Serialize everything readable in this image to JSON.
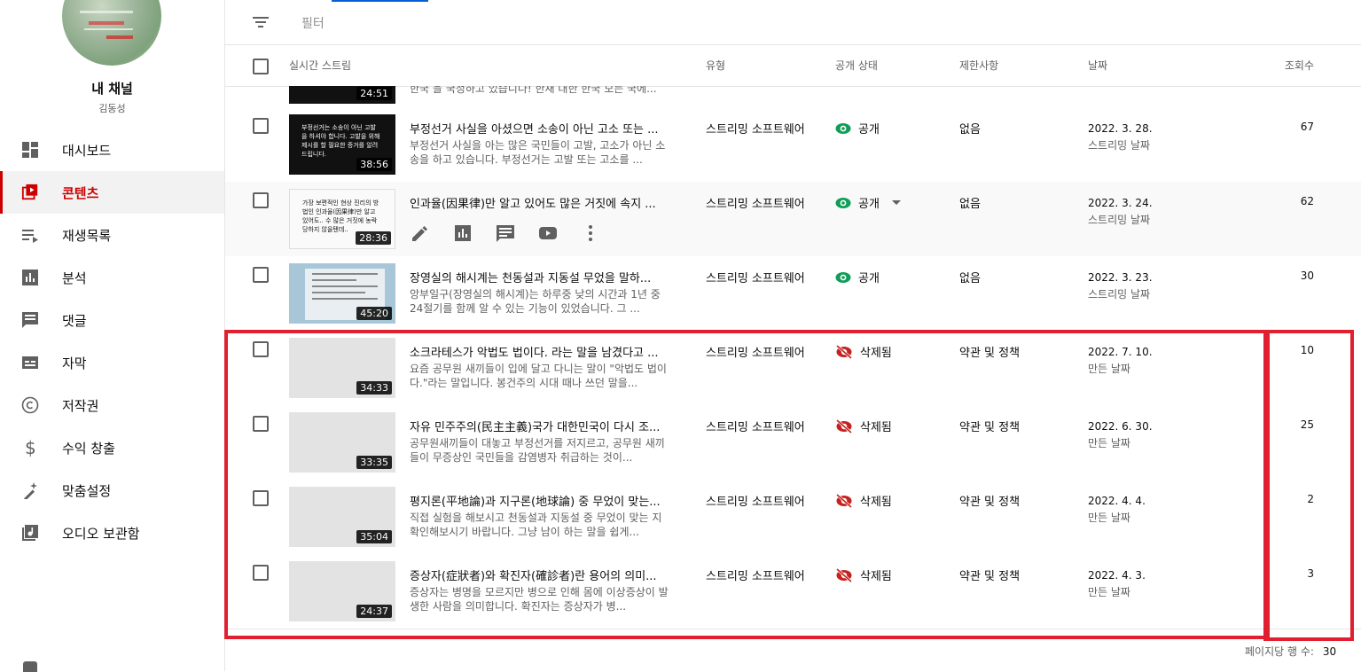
{
  "sidebar": {
    "channel_name": "내 채널",
    "channel_owner": "김동성",
    "items": [
      {
        "label": "대시보드",
        "icon": "dashboard-icon"
      },
      {
        "label": "콘텐츠",
        "icon": "content-icon",
        "active": true
      },
      {
        "label": "재생목록",
        "icon": "playlist-icon"
      },
      {
        "label": "분석",
        "icon": "analytics-icon"
      },
      {
        "label": "댓글",
        "icon": "comments-icon"
      },
      {
        "label": "자막",
        "icon": "subtitles-icon"
      },
      {
        "label": "저작권",
        "icon": "copyright-icon"
      },
      {
        "label": "수익 창출",
        "icon": "dollar-icon"
      },
      {
        "label": "맞춤설정",
        "icon": "magic-wand-icon"
      },
      {
        "label": "오디오 보관함",
        "icon": "audio-library-icon"
      }
    ]
  },
  "filter": {
    "placeholder": "필터"
  },
  "columns": {
    "stream": "실시간 스트림",
    "type": "유형",
    "visibility": "공개 상태",
    "restrictions": "제한사항",
    "date": "날짜",
    "views": "조회수"
  },
  "rows": [
    {
      "title": "부정선거 사실을 아셨으면 소송이 아닌 고소 또는 ...",
      "desc": "부정선거 사실을 아는 많은 국민들이 고발, 고소가 아닌 소송을 하고 있습니다. 부정선거는 고발 또는 고소를 ...",
      "thumb_text": "부정선거는 소송이 아닌 고발을 하셔야 합니다. 고발을 위해 제시를 할 필요한 증거를 알려드립니다.",
      "duration": "38:56",
      "type": "스트리밍 소프트웨어",
      "visibility": "공개",
      "restrictions": "없음",
      "date": "2022. 3. 28.",
      "date_sub": "스트리밍 날짜",
      "views": "67"
    },
    {
      "title": "인과율(因果律)만 알고 있어도 많은 거짓에 속지 ...",
      "desc": "",
      "thumb_text": "가장 보편적인 현상 진리의 방법인 인과율(因果律)만 알고 있어도.. 수 많은 거짓에 농락당하지 않을텐데..",
      "duration": "28:36",
      "type": "스트리밍 소프트웨어",
      "visibility": "공개",
      "restrictions": "없음",
      "date": "2022. 3. 24.",
      "date_sub": "스트리밍 날짜",
      "views": "62"
    },
    {
      "title": "장영실의 해시계는 천동설과 지동설 무었을 말하...",
      "desc": "앙부일구(장영실의 해시계)는 하루중 낮의 시간과 1년 중 24절기를 함께 알 수 있는 기능이 있었습니다. 그 ...",
      "thumb_text": "",
      "duration": "45:20",
      "type": "스트리밍 소프트웨어",
      "visibility": "공개",
      "restrictions": "없음",
      "date": "2022. 3. 23.",
      "date_sub": "스트리밍 날짜",
      "views": "30"
    },
    {
      "title": "소크라테스가 악법도 법이다. 라는 말을 남겼다고 ...",
      "desc": "요즘 공무원 새끼들이 입에 달고 다니는 말이 \"악법도 법이다.\"라는 말입니다. 봉건주의 시대 때나 쓰던 말을...",
      "thumb_text": "",
      "duration": "34:33",
      "type": "스트리밍 소프트웨어",
      "visibility": "삭제됨",
      "restrictions": "약관 및 정책",
      "date": "2022. 7. 10.",
      "date_sub": "만든 날짜",
      "views": "10"
    },
    {
      "title": "자유 민주주의(民主主義)국가 대한민국이 다시 조...",
      "desc": "공무원새끼들이 대놓고 부정선거를 저지르고, 공무원 새끼들이 무증상인 국민들을 감염병자 취급하는 것이...",
      "thumb_text": "",
      "duration": "33:35",
      "type": "스트리밍 소프트웨어",
      "visibility": "삭제됨",
      "restrictions": "약관 및 정책",
      "date": "2022. 6. 30.",
      "date_sub": "만든 날짜",
      "views": "25"
    },
    {
      "title": "평지론(平地論)과 지구론(地球論) 중 무었이 맞는...",
      "desc": "직접 실험을 해보시고 천동설과 지동설 중 무었이 맞는 지 확인해보시기 바랍니다. 그냥 남이 하는 말을 쉽게...",
      "thumb_text": "",
      "duration": "35:04",
      "type": "스트리밍 소프트웨어",
      "visibility": "삭제됨",
      "restrictions": "약관 및 정책",
      "date": "2022. 4. 4.",
      "date_sub": "만든 날짜",
      "views": "2"
    },
    {
      "title": "증상자(症狀者)와 확진자(確診者)란 용어의 의미...",
      "desc": "증상자는 병명을 모르지만 병으로 인해 몸에 이상증상이 발생한 사람을 의미합니다. 확진자는 증상자가 병...",
      "thumb_text": "",
      "duration": "24:37",
      "type": "스트리밍 소프트웨어",
      "visibility": "삭제됨",
      "restrictions": "약관 및 정책",
      "date": "2022. 4. 3.",
      "date_sub": "만든 날짜",
      "views": "3"
    }
  ],
  "partial_row": {
    "duration": "24:51",
    "desc": "한국 을 국정하고 있습니다! 한재 대한 한국 모든 국에..."
  },
  "footer": {
    "rows_per_page_label": "페이지당 행 수:",
    "rows_per_page": "30"
  },
  "colors": {
    "accent": "#cc0000",
    "public": "#0f9d58",
    "deleted": "#c5221f",
    "highlight": "#e02030"
  }
}
